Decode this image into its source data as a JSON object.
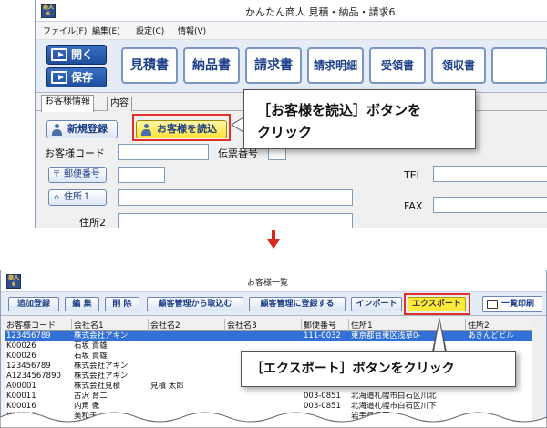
{
  "top_window": {
    "title": "かんたん商人 見積・納品・請求6",
    "app_icon_text": "商人6",
    "menu": [
      "ファイル(F)",
      "編集(E)",
      "設定(C)",
      "情報(V)"
    ],
    "nav_buttons": [
      "開く",
      "保存"
    ],
    "doc_buttons": [
      "見積書",
      "納品書",
      "請求書",
      "請求明細",
      "受領書",
      "領収書"
    ],
    "tabs": [
      "お客様情報",
      "内容"
    ],
    "new_button": "新規登録",
    "load_button": "お客様を読込",
    "customer_code_label": "お客様コード",
    "slip_label": "伝票番号",
    "postal_button": "郵便番号",
    "postal_icon": "〒",
    "address1_button": "住所１",
    "address2_label": "住所2",
    "tel_label": "TEL",
    "fax_label": "FAX"
  },
  "callout1": {
    "line1": "［お客様を読込］ボタンを",
    "line2": "クリック"
  },
  "bottom_window": {
    "title": "お客様一覧",
    "toolbar": [
      "追加登録",
      "編 集",
      "削 除",
      "顧客管理から取込む",
      "顧客管理に登録する",
      "インポート",
      "エクスポート"
    ],
    "print_button": "一覧印刷",
    "columns": [
      "お客様コード",
      "会社名1",
      "会社名2",
      "会社名3",
      "郵便番号",
      "住所1",
      "住所2"
    ],
    "rows": [
      [
        "123456789",
        "株式会社アキン",
        "",
        "",
        "111-0032",
        "東京都台東区浅草0-",
        "あきんどビル"
      ],
      [
        "K00026",
        "石坂 貴雄",
        "",
        "",
        "",
        "",
        ""
      ],
      [
        "K00026",
        "石坂 貴雄",
        "",
        "",
        "",
        "",
        ""
      ],
      [
        "123456789",
        "株式会社アキン",
        "",
        "",
        "",
        "",
        ""
      ],
      [
        "A1234567890",
        "株式会社アキン",
        "",
        "",
        "",
        "",
        ""
      ],
      [
        "A00001",
        "株式会社見積",
        "見積 太郎",
        "",
        "",
        "",
        ""
      ],
      [
        "K00011",
        "古沢 育二",
        "",
        "",
        "003-0851",
        "北海道札幌市白石区川北",
        ""
      ],
      [
        "K00016",
        "内角 徹",
        "",
        "",
        "003-0851",
        "北海道札幌市白石区川下",
        ""
      ],
      [
        "K00003",
        "美和子",
        "",
        "",
        "",
        "岩手県盛岡",
        ""
      ]
    ]
  },
  "callout2": {
    "text": "［エクスポート］ボタンをクリック"
  },
  "colors": {
    "accent_blue": "#1e4f9e",
    "highlight_red": "#e0302a",
    "export_yellow": "#ffe93b",
    "selection_blue": "#3270d6"
  }
}
